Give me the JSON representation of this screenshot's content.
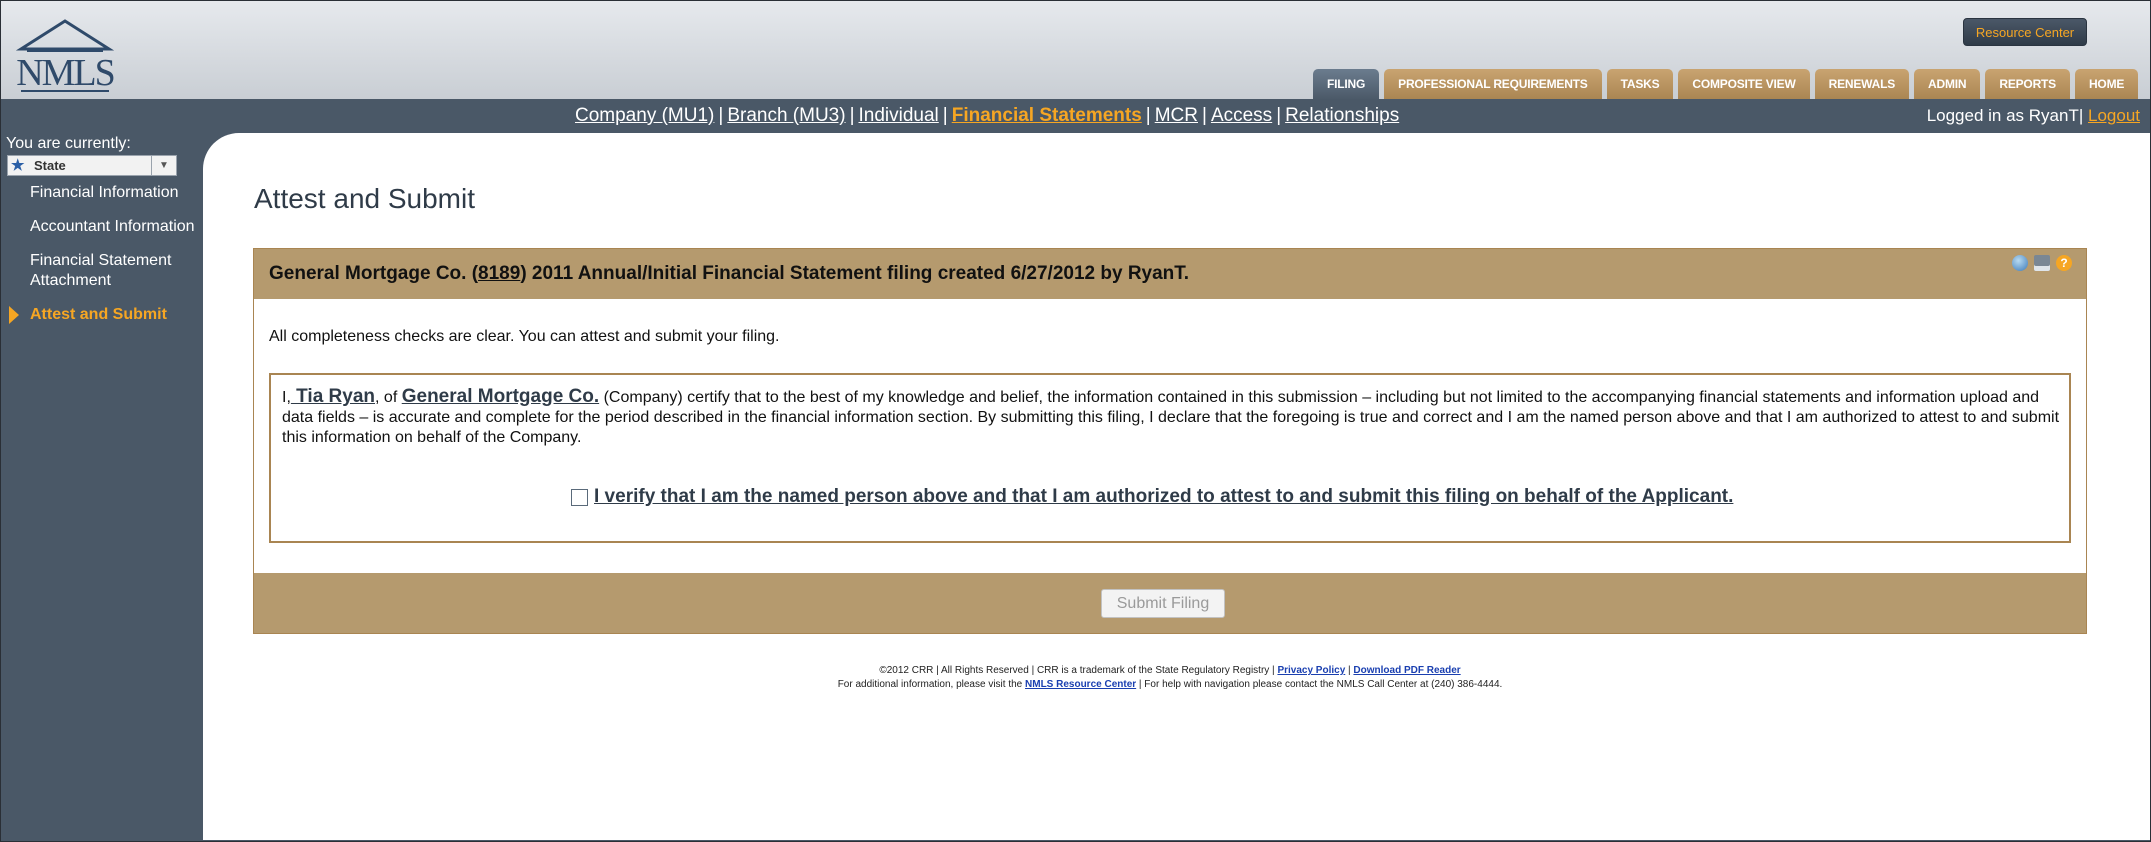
{
  "header": {
    "logo_text": "NMLS",
    "resource_center": "Resource Center",
    "tabs": [
      {
        "label": "FILING",
        "active": true
      },
      {
        "label": "PROFESSIONAL REQUIREMENTS",
        "active": false
      },
      {
        "label": "TASKS",
        "active": false
      },
      {
        "label": "COMPOSITE VIEW",
        "active": false
      },
      {
        "label": "RENEWALS",
        "active": false
      },
      {
        "label": "ADMIN",
        "active": false
      },
      {
        "label": "REPORTS",
        "active": false
      },
      {
        "label": "HOME",
        "active": false
      }
    ]
  },
  "subnav": {
    "links": [
      {
        "label": "Company (MU1)"
      },
      {
        "label": "Branch (MU3)"
      },
      {
        "label": "Individual"
      },
      {
        "label": "Financial Statements",
        "current": true
      },
      {
        "label": "MCR"
      },
      {
        "label": "Access"
      },
      {
        "label": "Relationships"
      }
    ],
    "separator": "|",
    "logged_in": "Logged in as RyanT",
    "logout": "Logout"
  },
  "sidebar": {
    "you_are": "You are currently:",
    "state_select": "State",
    "items": [
      {
        "label": "Financial Information"
      },
      {
        "label": "Accountant Information"
      },
      {
        "label": "Financial Statement Attachment"
      },
      {
        "label": "Attest and Submit",
        "active": true
      }
    ]
  },
  "main": {
    "page_title": "Attest and Submit",
    "panel": {
      "header_pre": "General Mortgage Co. (",
      "header_id": "8189",
      "header_post": ") 2011 Annual/Initial Financial Statement filing created 6/27/2012 by RyanT.",
      "completeness": "All completeness checks are clear. You can attest and submit your filing.",
      "attest_i": "I,",
      "attest_person": " Tia Ryan",
      "attest_of": ", of ",
      "attest_company": "General Mortgage Co.",
      "attest_text": " (Company) certify that to the best of my knowledge and belief, the information contained in this submission – including but not limited to the accompanying financial statements and information upload and data fields – is accurate and complete for the period described in the financial information section. By submitting this filing, I declare that the foregoing is true and correct and I am the named person above and that I am authorized to attest to and submit this information on behalf of the Company.",
      "verify_label": "I verify that I am the named person above and that I am authorized to attest to and submit this filing on behalf of the Applicant.",
      "verify_checked": false,
      "submit": "Submit Filing"
    }
  },
  "footer": {
    "line1_pre": "©2012 CRR | All Rights Reserved | CRR is a trademark of the State Regulatory Registry | ",
    "privacy": "Privacy Policy",
    "line1_sep": " | ",
    "pdf": "Download PDF Reader",
    "line2_pre": "For additional information, please visit the ",
    "resource_center": "NMLS Resource Center",
    "line2_post": " | For help with navigation please contact the NMLS Call Center at (240) 386-4444."
  }
}
